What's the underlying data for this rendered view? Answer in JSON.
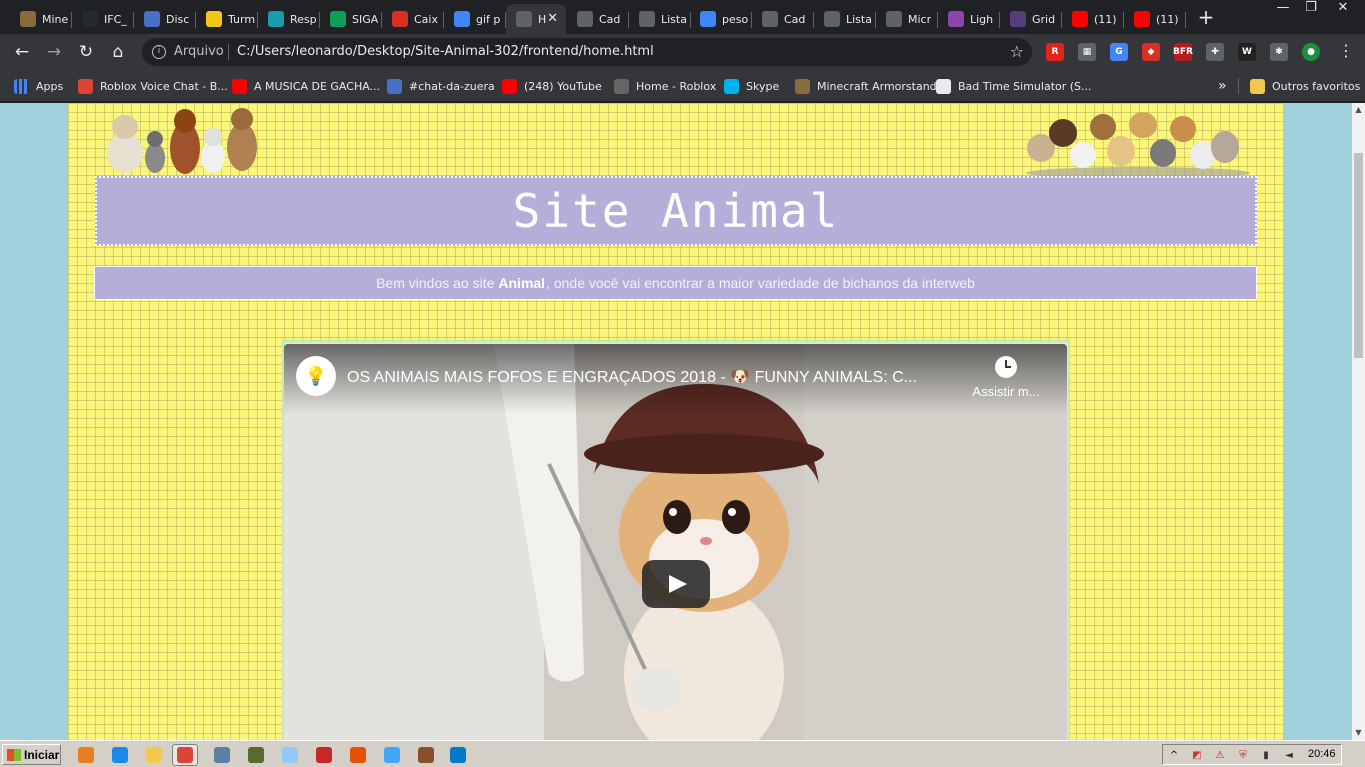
{
  "browser": {
    "tabs": [
      {
        "title": "Mine",
        "icon": "minecraft-icon",
        "color": "#8a6b3c"
      },
      {
        "title": "IFC_",
        "icon": "github-icon",
        "color": "#24292e"
      },
      {
        "title": "Disc",
        "icon": "discord-6k-icon",
        "color": "#4a6fc7"
      },
      {
        "title": "Turm",
        "icon": "classroom-icon",
        "color": "#f5c518"
      },
      {
        "title": "Resp",
        "icon": "classroom-person-icon",
        "color": "#1a9bb0"
      },
      {
        "title": "SIGA",
        "icon": "siga-icon",
        "color": "#0f9d58"
      },
      {
        "title": "Caix",
        "icon": "gmail-icon",
        "color": "#d93025"
      },
      {
        "title": "gif p",
        "icon": "google-icon",
        "color": "#4285f4"
      },
      {
        "title": "H",
        "icon": "globe-icon",
        "color": "#5f6368",
        "active": true
      },
      {
        "title": "Cad",
        "icon": "globe-icon",
        "color": "#5f6368"
      },
      {
        "title": "Lista",
        "icon": "globe-icon",
        "color": "#5f6368"
      },
      {
        "title": "peso",
        "icon": "google-icon",
        "color": "#4285f4"
      },
      {
        "title": "Cad",
        "icon": "globe-icon",
        "color": "#5f6368"
      },
      {
        "title": "Lista",
        "icon": "globe-icon",
        "color": "#5f6368"
      },
      {
        "title": "Micr",
        "icon": "globe-icon",
        "color": "#5f6368"
      },
      {
        "title": "Ligh",
        "icon": "feather-icon",
        "color": "#8e44ad"
      },
      {
        "title": "Grid",
        "icon": "bootstrap-icon",
        "color": "#563d7c"
      },
      {
        "title": "(11)",
        "icon": "youtube-icon",
        "color": "#ff0000"
      },
      {
        "title": "(11)",
        "icon": "youtube-icon",
        "color": "#ff0000"
      }
    ],
    "new_tab_label": "+",
    "window_controls": {
      "minimize": "—",
      "restore": "❐",
      "close": "✕"
    },
    "address_bar": {
      "security_label": "Arquivo",
      "url": "C:/Users/leonardo/Desktop/Site-Animal-302/frontend/home.html"
    },
    "extensions": [
      {
        "icon": "roblox-ext-icon",
        "color": "#e2231a",
        "glyph": "R"
      },
      {
        "icon": "keyboard-ext-icon",
        "color": "#5f6368",
        "glyph": "▦"
      },
      {
        "icon": "google-translate-icon",
        "color": "#4285f4",
        "glyph": "G"
      },
      {
        "icon": "shield-ext-icon",
        "color": "#d93025",
        "glyph": "◆"
      },
      {
        "icon": "bfr-ext-icon",
        "color": "#b71c1c",
        "glyph": "BFR"
      },
      {
        "icon": "puzzle-piece-ext-icon",
        "color": "#5f6368",
        "glyph": "✚"
      },
      {
        "icon": "wappalyzer-icon",
        "color": "#222222",
        "glyph": "W"
      },
      {
        "icon": "extensions-icon",
        "color": "#5f6368",
        "glyph": "✱"
      },
      {
        "icon": "profile-avatar-icon",
        "color": "#1e8e3e",
        "glyph": "●"
      }
    ],
    "bookmarks": [
      {
        "label": "Apps",
        "icon": "apps-grid-icon",
        "color": "#4285f4"
      },
      {
        "label": "Roblox Voice Chat - B...",
        "icon": "chrome-icon",
        "color": "#db4437"
      },
      {
        "label": "A MUSICA DE GACHA...",
        "icon": "youtube-icon",
        "color": "#ff0000"
      },
      {
        "label": "#chat-da-zuera",
        "icon": "discord-6k-icon",
        "color": "#4a6fc7"
      },
      {
        "label": "(248) YouTube",
        "icon": "youtube-icon",
        "color": "#ff0000"
      },
      {
        "label": "Home - Roblox",
        "icon": "roblox-icon",
        "color": "#666666"
      },
      {
        "label": "Skype",
        "icon": "skype-icon",
        "color": "#00aff0"
      },
      {
        "label": "Minecraft Armorstand",
        "icon": "armorstand-icon",
        "color": "#8a6b3c"
      },
      {
        "label": "Bad Time Simulator (S...",
        "icon": "skull-icon",
        "color": "#e8eaed"
      }
    ],
    "bookmarks_overflow": "»",
    "other_bookmarks": {
      "label": "Outros favoritos",
      "icon": "folder-icon",
      "color": "#f2c94c"
    }
  },
  "site": {
    "title": "Site Animal",
    "welcome_before": "Bem vindos ao site",
    "welcome_bold": "Animal",
    "welcome_after": ", onde você vai encontrar a maior variedade de bichanos da interweb",
    "video": {
      "title": "OS ANIMAIS MAIS FOFOS E ENGRAÇADOS 2018 - 🐶 FUNNY ANIMALS: C...",
      "watch_later": "Assistir m...",
      "channel_icon": "lightbulb-icon"
    },
    "colors": {
      "page_bg": "#fbf67a",
      "panel": "#b5aed8",
      "outside": "#9fd1dd"
    }
  },
  "taskbar": {
    "start_label": "Iniciar",
    "apps": [
      {
        "icon": "media-player-icon",
        "color": "#e67e22"
      },
      {
        "icon": "internet-explorer-icon",
        "color": "#1e88e5"
      },
      {
        "icon": "file-explorer-icon",
        "color": "#f2c94c"
      },
      {
        "icon": "chrome-icon",
        "color": "#db4437",
        "active": true
      },
      {
        "icon": "calculator-icon",
        "color": "#5c7fa3"
      },
      {
        "icon": "minecraft-icon",
        "color": "#556b2f"
      },
      {
        "icon": "notepad-icon",
        "color": "#90caf9"
      },
      {
        "icon": "record-icon",
        "color": "#c62828"
      },
      {
        "icon": "firefox-icon",
        "color": "#e65100"
      },
      {
        "icon": "paint-icon",
        "color": "#42a5f5"
      },
      {
        "icon": "stickman-icon",
        "color": "#8d4e2a"
      },
      {
        "icon": "vscode-icon",
        "color": "#007acc"
      }
    ],
    "tray": [
      "show-hidden-icon",
      "antivirus-icon",
      "network-warning-icon",
      "security-alert-icon",
      "signal-icon",
      "volume-icon"
    ],
    "time": "20:46"
  }
}
